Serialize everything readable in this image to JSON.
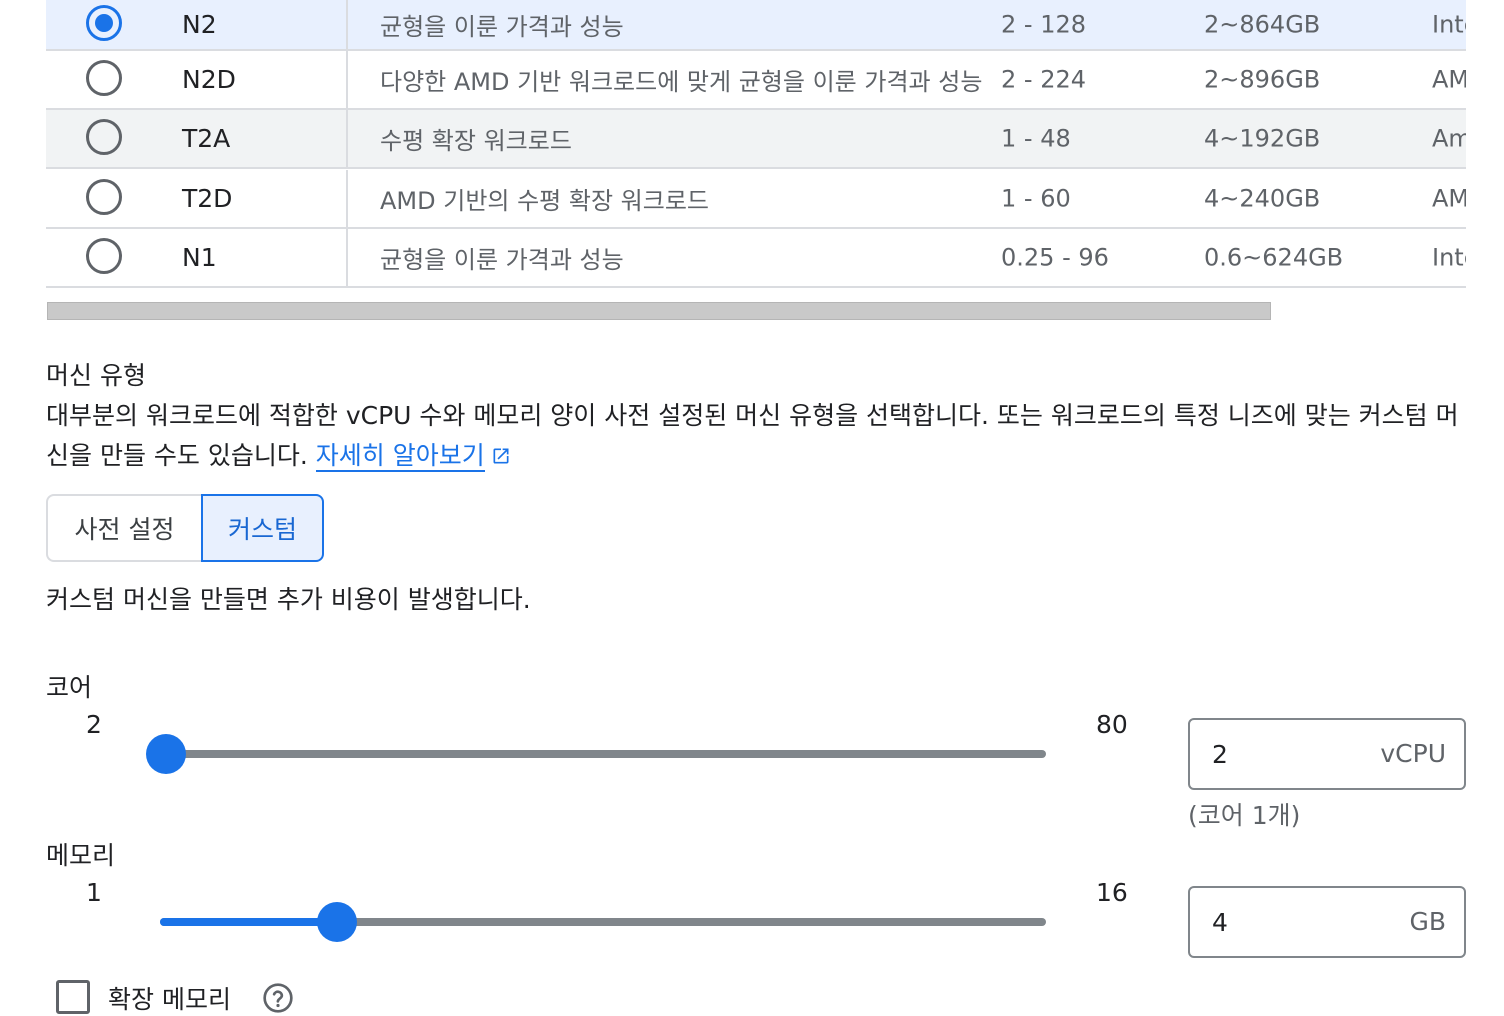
{
  "series_table": {
    "rows": [
      {
        "series": "N2",
        "description": "균형을 이룬 가격과 성능",
        "vcpus": "2 - 128",
        "memory": "2~864GB",
        "platform": "Inte",
        "selected": true
      },
      {
        "series": "N2D",
        "description": "다양한 AMD 기반 워크로드에 맞게 균형을 이룬 가격과 성능",
        "vcpus": "2 - 224",
        "memory": "2~896GB",
        "platform": "AM",
        "selected": false
      },
      {
        "series": "T2A",
        "description": "수평 확장 워크로드",
        "vcpus": "1 - 48",
        "memory": "4~192GB",
        "platform": "Am",
        "selected": false
      },
      {
        "series": "T2D",
        "description": "AMD 기반의 수평 확장 워크로드",
        "vcpus": "1 - 60",
        "memory": "4~240GB",
        "platform": "AM",
        "selected": false
      },
      {
        "series": "N1",
        "description": "균형을 이룬 가격과 성능",
        "vcpus": "0.25 - 96",
        "memory": "0.6~624GB",
        "platform": "Inte",
        "selected": false
      }
    ]
  },
  "machine_type": {
    "title": "머신 유형",
    "description": "대부분의 워크로드에 적합한 vCPU 수와 메모리 양이 사전 설정된 머신 유형을 선택합니다. 또는 워크로드의 특정 니즈에 맞는 커스텀 머신을 만들 수도 있습니다.",
    "learn_more": "자세히 알아보기",
    "learn_more_icon": "external-link-icon",
    "toggle": {
      "preset": "사전 설정",
      "custom": "커스텀",
      "selected": "custom"
    },
    "custom_note": "커스텀 머신을 만들면 추가 비용이 발생합니다."
  },
  "cores": {
    "label": "코어",
    "min": "2",
    "max": "80",
    "value": "2",
    "unit": "vCPU",
    "hint": "(코어 1개)",
    "slider_fraction": 0.0
  },
  "memory": {
    "label": "메모리",
    "min": "1",
    "max": "16",
    "value": "4",
    "unit": "GB",
    "slider_fraction": 0.2
  },
  "extended_memory": {
    "label": "확장 메모리",
    "checked": false,
    "help_icon": "help-circle-icon"
  },
  "colors": {
    "accent": "#1a73e8",
    "selected_row": "#e8f0fe",
    "shaded_row": "#f1f3f4"
  }
}
